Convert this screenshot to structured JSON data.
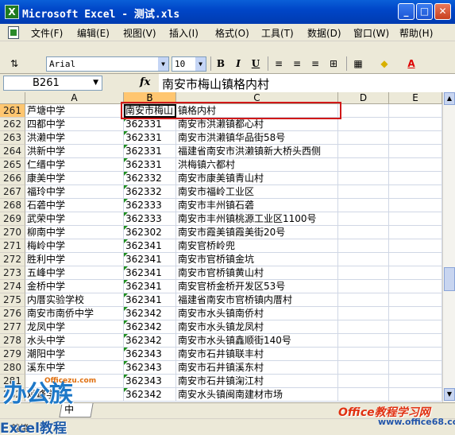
{
  "window": {
    "title": "Microsoft Excel - 测试.xls",
    "app_icon": "excel-icon",
    "minimize": "_",
    "maximize": "□",
    "close": "✕"
  },
  "menu": {
    "items": [
      "文件(F)",
      "编辑(E)",
      "视图(V)",
      "插入(I)",
      "格式(O)",
      "工具(T)",
      "数据(D)",
      "窗口(W)",
      "帮助(H)"
    ],
    "mdi_controls": [
      "_",
      "⧉",
      "✕"
    ]
  },
  "toolbar": {
    "font_name": "Arial",
    "font_size": "10",
    "bold": "B",
    "italic": "I",
    "underline": "U",
    "fill_label": "A"
  },
  "formula_bar": {
    "name_box": "B261",
    "fx": "fx",
    "content": "南安市梅山镇格内村"
  },
  "sheet": {
    "columns": [
      "A",
      "B",
      "C",
      "D",
      "E"
    ],
    "selected_column": "B",
    "selected_row": "261",
    "rows": [
      {
        "num": "261",
        "a": "芦塘中学",
        "b": "南安市梅山",
        "c": "镇格内村"
      },
      {
        "num": "262",
        "a": "四都中学",
        "b": "362331",
        "c": "南安市洪濑镇都心村"
      },
      {
        "num": "263",
        "a": "洪濑中学",
        "b": "362331",
        "c": "南安市洪濑镇华品街58号"
      },
      {
        "num": "264",
        "a": "洪新中学",
        "b": "362331",
        "c": "福建省南安市洪濑镇新大桥头西侧"
      },
      {
        "num": "265",
        "a": "仁缙中学",
        "b": "362331",
        "c": "洪梅镇六都村"
      },
      {
        "num": "266",
        "a": "康美中学",
        "b": "362332",
        "c": "南安市康美镇青山村"
      },
      {
        "num": "267",
        "a": "福玲中学",
        "b": "362332",
        "c": "南安市福岭工业区"
      },
      {
        "num": "268",
        "a": "石砻中学",
        "b": "362333",
        "c": "南安市丰州镇石砻"
      },
      {
        "num": "269",
        "a": "武荣中学",
        "b": "362333",
        "c": "南安市丰州镇桃源工业区1100号"
      },
      {
        "num": "270",
        "a": "柳南中学",
        "b": "362302",
        "c": "南安市霞美镇霞美街20号"
      },
      {
        "num": "271",
        "a": "梅岭中学",
        "b": "362341",
        "c": "南安官桥岭兜"
      },
      {
        "num": "272",
        "a": "胜利中学",
        "b": "362341",
        "c": "南安市官桥镇金坑"
      },
      {
        "num": "273",
        "a": "五峰中学",
        "b": "362341",
        "c": "南安市官桥镇黄山村"
      },
      {
        "num": "274",
        "a": "金桥中学",
        "b": "362341",
        "c": "南安官桥金桥开发区53号"
      },
      {
        "num": "275",
        "a": "内厝实验学校",
        "b": "362341",
        "c": "福建省南安市官桥镇内厝村"
      },
      {
        "num": "276",
        "a": "南安市南侨中学",
        "b": "362342",
        "c": "南安市水头镇南侨村"
      },
      {
        "num": "277",
        "a": "龙凤中学",
        "b": "362342",
        "c": "南安市水头镇龙凤村"
      },
      {
        "num": "278",
        "a": "水头中学",
        "b": "362342",
        "c": "南安市水头镇鑫顺街140号"
      },
      {
        "num": "279",
        "a": "潮阳中学",
        "b": "362343",
        "c": "南安市石井镇联丰村"
      },
      {
        "num": "280",
        "a": "溪东中学",
        "b": "362343",
        "c": "南安市石井镇溪东村"
      },
      {
        "num": "281",
        "a": "",
        "b": "362343",
        "c": "南安市石井镇淗江村"
      },
      {
        "num": "282",
        "a": "观峰学校",
        "b": "362342",
        "c": "南安水头镇闽南建材市场"
      }
    ]
  },
  "sheet_tab": "中",
  "status": "就绪",
  "watermarks": {
    "left_big": "办公族",
    "left_url": "Officezu.com",
    "bottom": "Excel教程",
    "right": "Office教程学习网",
    "right_url": "www.office68.com"
  },
  "colors": {
    "titlebar": "#0046c8",
    "selected_header": "#ffc670",
    "highlight_box": "#d01818",
    "number_text_marker": "#1e8e1e"
  }
}
